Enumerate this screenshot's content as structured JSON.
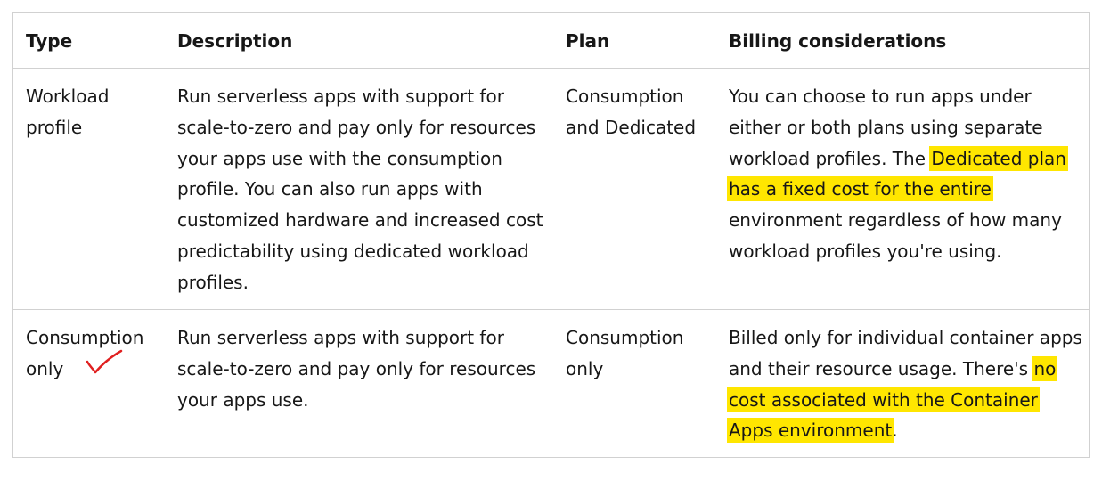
{
  "table": {
    "headers": {
      "type": "Type",
      "description": "Description",
      "plan": "Plan",
      "billing": "Billing considerations"
    },
    "rows": [
      {
        "type": "Workload profile",
        "description": "Run serverless apps with support for scale-to-zero and pay only for resources your apps use with the consumption profile. You can also run apps with customized hardware and increased cost predictability using dedicated workload profiles.",
        "plan": "Consumption and Dedicated",
        "billing_before": "You can choose to run apps under either or both plans using separate workload profiles. The ",
        "billing_highlight": "Dedicated plan has a fixed cost for the entire",
        "billing_after": " environment regardless of how many workload profiles you're using."
      },
      {
        "type": "Consumption only",
        "description": "Run serverless apps with support for scale-to-zero and pay only for resources your apps use.",
        "plan": "Consumption only",
        "billing_before": "Billed only for individual container apps and their resource usage. There's ",
        "billing_highlight": "no cost associated with the Container Apps environment",
        "billing_after": "."
      }
    ]
  },
  "annotations": {
    "highlight_color": "#ffe600",
    "checkmark_color": "#e02020",
    "checkmark_icon": "checkmark-icon"
  }
}
